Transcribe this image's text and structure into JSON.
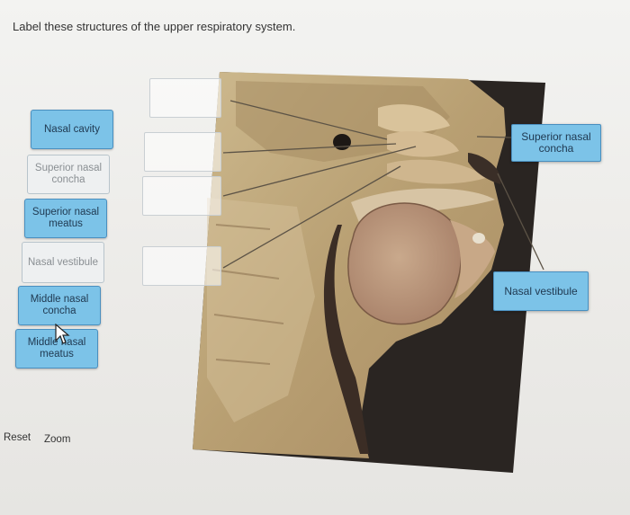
{
  "instruction": "Label these structures of the upper respiratory system.",
  "word_bank": [
    {
      "label": "Nasal cavity",
      "state": "active"
    },
    {
      "label": "Superior nasal concha",
      "state": "used"
    },
    {
      "label": "Superior nasal meatus",
      "state": "active"
    },
    {
      "label": "Nasal vestibule",
      "state": "used"
    },
    {
      "label": "Middle nasal concha",
      "state": "active"
    },
    {
      "label": "Middle nasal meatus",
      "state": "active"
    }
  ],
  "placed_labels": {
    "right_top": "Superior nasal concha",
    "right_mid": "Nasal vestibule"
  },
  "controls": {
    "reset": "Reset",
    "zoom": "Zoom"
  },
  "colors": {
    "label_fill": "#7cc3e8",
    "label_border": "#4a8fbf",
    "used_fill": "#eef0f1"
  }
}
